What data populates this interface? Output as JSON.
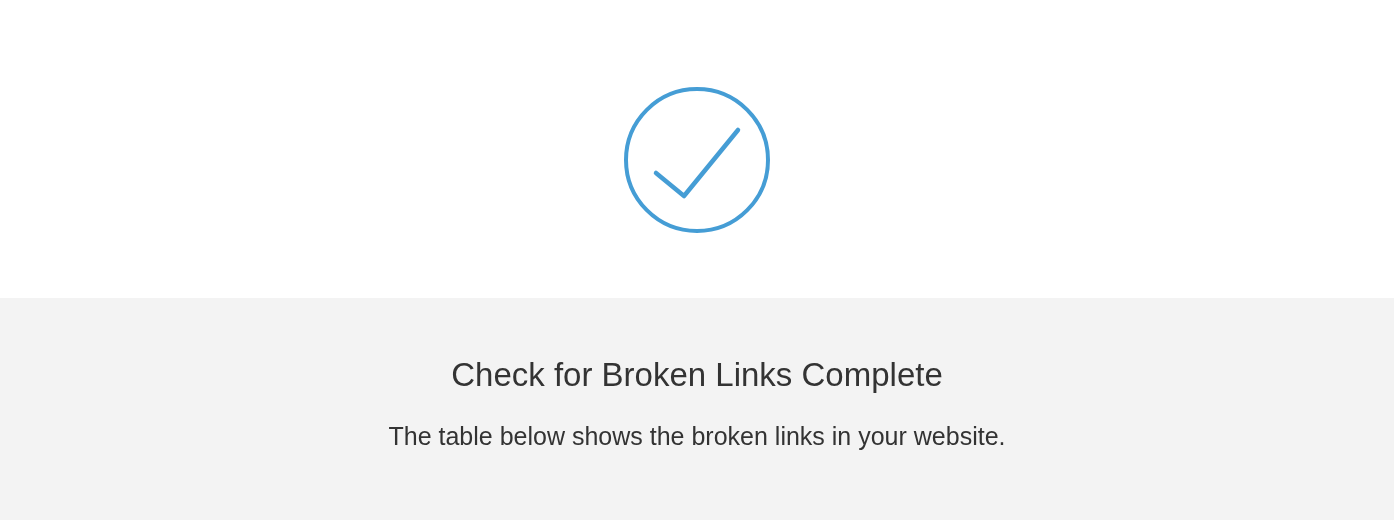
{
  "status": {
    "title": "Check for Broken Links Complete",
    "message": "The table below shows the broken links in your website."
  }
}
